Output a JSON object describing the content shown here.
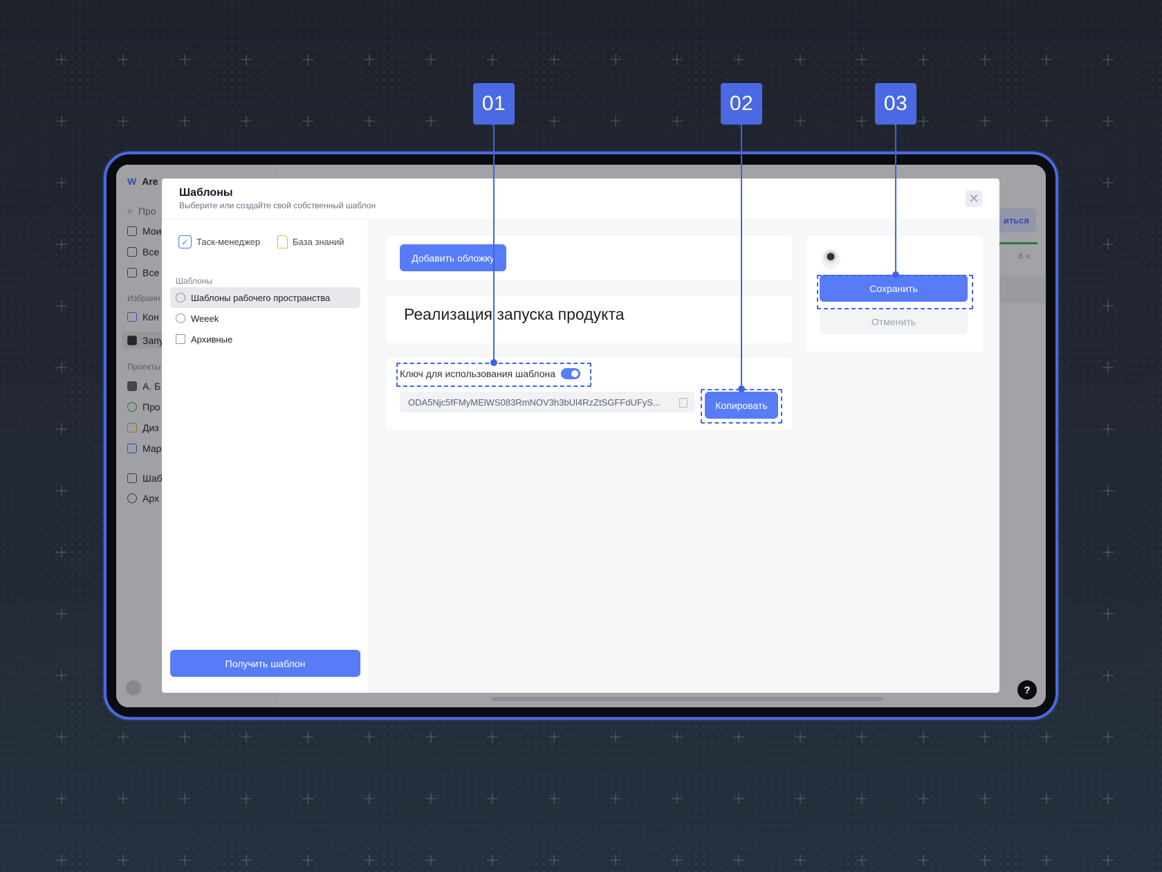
{
  "callouts": [
    "01",
    "02",
    "03"
  ],
  "background_app": {
    "workspace_short": "Are",
    "search_short": "Про",
    "nav_items": [
      "Мои",
      "Все",
      "Все"
    ],
    "favorites_label": "Избранн",
    "favorites": [
      "Кон",
      "Запу"
    ],
    "projects_label": "Проекты",
    "projects": [
      "А. Б",
      "Про",
      "Диз",
      "Мар"
    ],
    "bottom_items": [
      "Шаб",
      "Арх"
    ],
    "right_button_partial": "иться",
    "hours_partial": "8 ч.",
    "help_label": "?"
  },
  "modal": {
    "title": "Шаблоны",
    "subtitle": "Выберите или создайте свой собственный шаблон",
    "close_icon": "close-icon",
    "categories": [
      {
        "label": "Таск-менеджер",
        "icon": "checkbox-icon"
      },
      {
        "label": "База знаний",
        "icon": "document-icon"
      }
    ],
    "templates_section": "Шаблоны",
    "templates": [
      {
        "label": "Шаблоны рабочего пространства",
        "icon": "team-icon",
        "active": true
      },
      {
        "label": "Weeek",
        "icon": "team-icon",
        "active": false
      },
      {
        "label": "Архивные",
        "icon": "archive-icon",
        "active": false
      }
    ],
    "get_template_button": "Получить шаблон",
    "add_cover_button": "Добавить обложку",
    "project_title": "Реализация запуска продукта",
    "key_label": "Ключ для использования шаблона",
    "key_value": "ODA5Njc5fFMyMElWS083RmNOV3h3bUl4RzZtSGFFdUFyS...",
    "copy_button": "Копировать",
    "save_button": "Сохранить",
    "cancel_button": "Отменить"
  },
  "colors": {
    "accent": "#587bf7",
    "annotation": "#3f63e6",
    "frame": "#4a69e2"
  }
}
